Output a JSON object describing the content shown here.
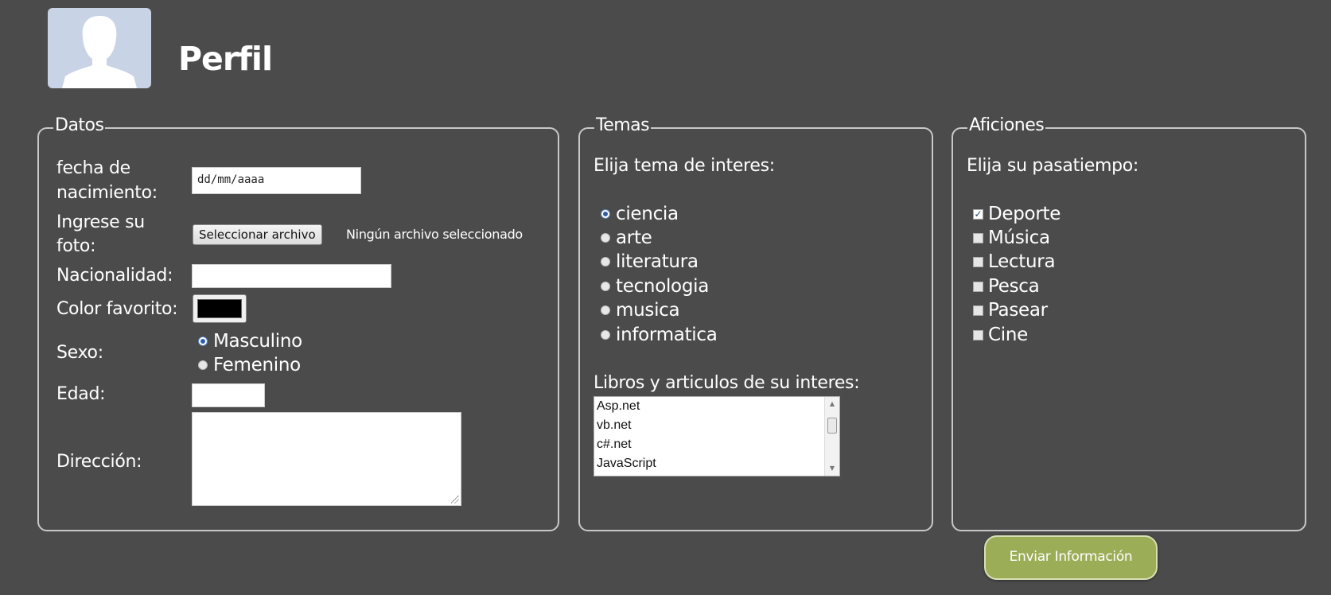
{
  "header": {
    "title": "Perfil"
  },
  "datos": {
    "legend": "Datos",
    "birth_label_line1": "fecha de",
    "birth_label_line2": "nacimiento:",
    "birth_placeholder": "dd/mm/aaaa",
    "photo_label_line1": "Ingrese su",
    "photo_label_line2": "foto:",
    "photo_button": "Seleccionar archivo",
    "photo_status": "Ningún archivo seleccionado",
    "nationality_label": "Nacionalidad:",
    "nationality_value": "",
    "color_label": "Color favorito:",
    "color_value": "#000000",
    "sex_label": "Sexo:",
    "sex_options": [
      {
        "label": "Masculino",
        "checked": true
      },
      {
        "label": "Femenino",
        "checked": false
      }
    ],
    "age_label": "Edad:",
    "age_value": "",
    "address_label": "Dirección:",
    "address_value": ""
  },
  "temas": {
    "legend": "Temas",
    "prompt": "Elija tema de interes:",
    "options": [
      {
        "label": "ciencia",
        "checked": true
      },
      {
        "label": "arte",
        "checked": false
      },
      {
        "label": "literatura",
        "checked": false
      },
      {
        "label": "tecnologia",
        "checked": false
      },
      {
        "label": "musica",
        "checked": false
      },
      {
        "label": "informatica",
        "checked": false
      }
    ],
    "books_label": "Libros y articulos de su interes:",
    "books": [
      "Asp.net",
      "vb.net",
      "c#.net",
      "JavaScript"
    ]
  },
  "aficiones": {
    "legend": "Aficiones",
    "prompt": "Elija su pasatiempo:",
    "options": [
      {
        "label": "Deporte",
        "checked": true
      },
      {
        "label": "Música",
        "checked": false
      },
      {
        "label": "Lectura",
        "checked": false
      },
      {
        "label": "Pesca",
        "checked": false
      },
      {
        "label": "Pasear",
        "checked": false
      },
      {
        "label": "Cine",
        "checked": false
      }
    ]
  },
  "submit": {
    "label": "Enviar Información"
  },
  "colors": {
    "background": "#4b4b4b",
    "button": "#9bad57",
    "avatar_bg": "#c9d3e6"
  }
}
